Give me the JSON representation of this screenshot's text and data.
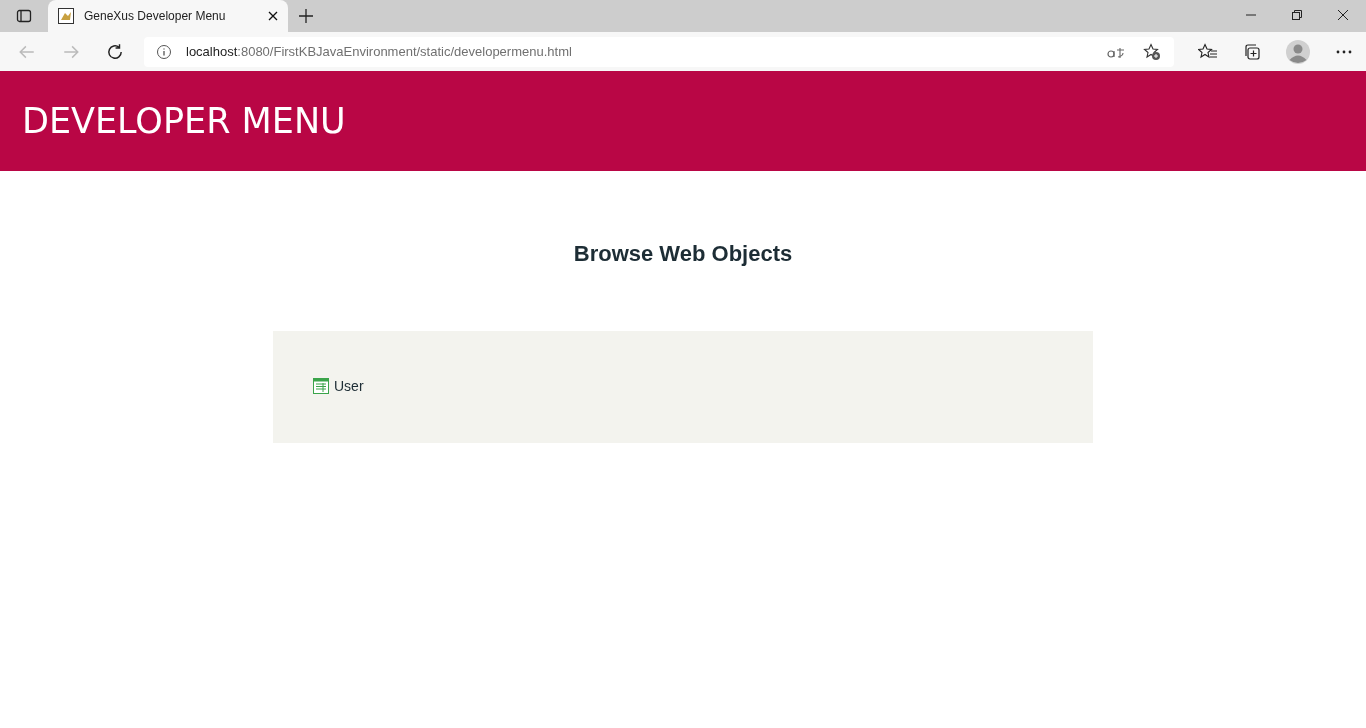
{
  "browser": {
    "tabs": [
      {
        "title": "GeneXus Developer Menu",
        "selected": true
      }
    ],
    "address": {
      "host": "localhost",
      "path": ":8080/FirstKBJavaEnvironment/static/developermenu.html"
    }
  },
  "header": {
    "title": "DEVELOPER MENU"
  },
  "section": {
    "title": "Browse Web Objects"
  },
  "objects": [
    {
      "label": "User"
    }
  ]
}
